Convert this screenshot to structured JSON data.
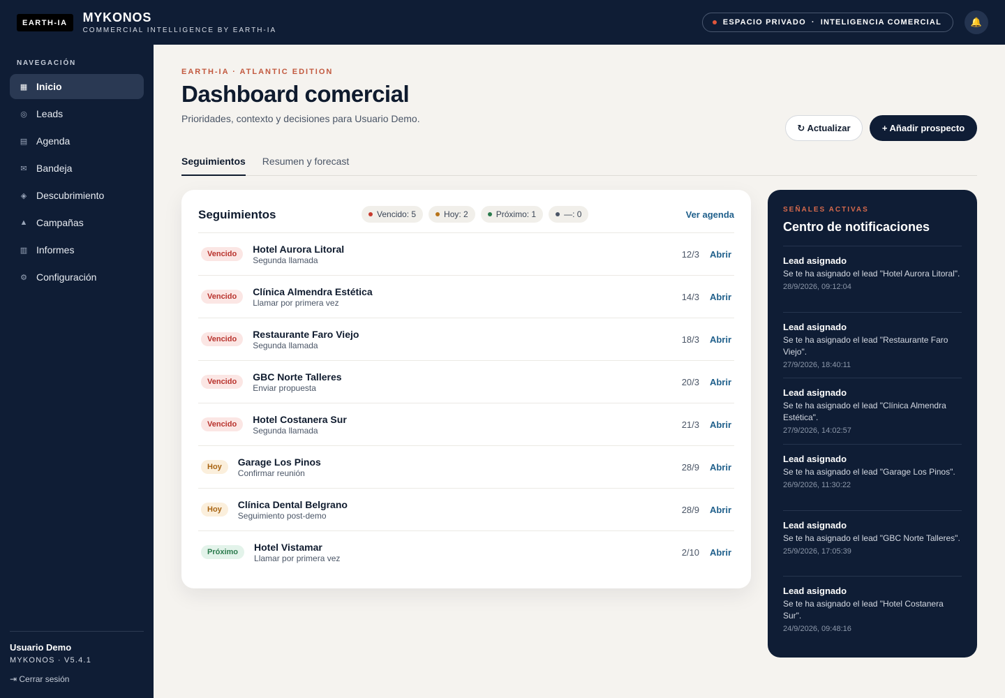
{
  "topbar": {
    "logo": "EARTH-IA",
    "brand_title": "MYKONOS",
    "brand_subtitle": "COMMERCIAL INTELLIGENCE BY EARTH-IA",
    "space_left": "ESPACIO PRIVADO",
    "space_sep": "·",
    "space_right": "INTELIGENCIA COMERCIAL",
    "bell_icon": "🔔"
  },
  "sidebar": {
    "heading": "NAVEGACIÓN",
    "items": [
      {
        "label": "Inicio",
        "icon": "▦",
        "name": "inicio"
      },
      {
        "label": "Leads",
        "icon": "◎",
        "name": "leads"
      },
      {
        "label": "Agenda",
        "icon": "▤",
        "name": "agenda"
      },
      {
        "label": "Bandeja",
        "icon": "✉",
        "name": "bandeja"
      },
      {
        "label": "Descubrimiento",
        "icon": "◈",
        "name": "descubrimiento"
      },
      {
        "label": "Campañas",
        "icon": "▲",
        "name": "campanas"
      },
      {
        "label": "Informes",
        "icon": "▥",
        "name": "informes"
      },
      {
        "label": "Configuración",
        "icon": "⚙",
        "name": "configuracion"
      }
    ],
    "active_index": 0,
    "user_name": "Usuario Demo",
    "version": "MYKONOS · V5.4.1",
    "logout": "⇥ Cerrar sesión"
  },
  "header": {
    "eyebrow": "EARTH-IA · ATLANTIC EDITION",
    "title": "Dashboard comercial",
    "subtitle": "Prioridades, contexto y decisiones para Usuario Demo.",
    "refresh_label": "↻ Actualizar",
    "add_label": "+ Añadir prospecto"
  },
  "tabs": [
    {
      "label": "Seguimientos",
      "active": true
    },
    {
      "label": "Resumen y forecast",
      "active": false
    }
  ],
  "followups": {
    "title": "Seguimientos",
    "link": "Ver agenda",
    "chips": [
      {
        "label": "Vencido: 5",
        "color": "#c73a2e"
      },
      {
        "label": "Hoy: 2",
        "color": "#b8741a"
      },
      {
        "label": "Próximo: 1",
        "color": "#2a7a4c"
      },
      {
        "label": "—: 0",
        "color": "#4a5566"
      }
    ],
    "open_label": "Abrir",
    "rows": [
      {
        "status": "Vencido",
        "kind": "vencido",
        "name": "Hotel Aurora Litoral",
        "task": "Segunda llamada",
        "date": "12/3"
      },
      {
        "status": "Vencido",
        "kind": "vencido",
        "name": "Clínica Almendra Estética",
        "task": "Llamar por primera vez",
        "date": "14/3"
      },
      {
        "status": "Vencido",
        "kind": "vencido",
        "name": "Restaurante Faro Viejo",
        "task": "Segunda llamada",
        "date": "18/3"
      },
      {
        "status": "Vencido",
        "kind": "vencido",
        "name": "GBC Norte Talleres",
        "task": "Enviar propuesta",
        "date": "20/3"
      },
      {
        "status": "Vencido",
        "kind": "vencido",
        "name": "Hotel Costanera Sur",
        "task": "Segunda llamada",
        "date": "21/3"
      },
      {
        "status": "Hoy",
        "kind": "hoy",
        "name": "Garage Los Pinos",
        "task": "Confirmar reunión",
        "date": "28/9"
      },
      {
        "status": "Hoy",
        "kind": "hoy",
        "name": "Clínica Dental Belgrano",
        "task": "Seguimiento post-demo",
        "date": "28/9"
      },
      {
        "status": "Próximo",
        "kind": "proximo",
        "name": "Hotel Vistamar",
        "task": "Llamar por primera vez",
        "date": "2/10"
      }
    ]
  },
  "notifications": {
    "eyebrow": "SEÑALES ACTIVAS",
    "title": "Centro de notificaciones",
    "items": [
      {
        "title": "Lead asignado",
        "body": "Se te ha asignado el lead \"Hotel Aurora Litoral\".",
        "time": "28/9/2026, 09:12:04"
      },
      {
        "title": "Lead asignado",
        "body": "Se te ha asignado el lead \"Restaurante Faro Viejo\".",
        "time": "27/9/2026, 18:40:11"
      },
      {
        "title": "Lead asignado",
        "body": "Se te ha asignado el lead \"Clínica Almendra Estética\".",
        "time": "27/9/2026, 14:02:57"
      },
      {
        "title": "Lead asignado",
        "body": "Se te ha asignado el lead \"Garage Los Pinos\".",
        "time": "26/9/2026, 11:30:22"
      },
      {
        "title": "Lead asignado",
        "body": "Se te ha asignado el lead \"GBC Norte Talleres\".",
        "time": "25/9/2026, 17:05:39"
      },
      {
        "title": "Lead asignado",
        "body": "Se te ha asignado el lead \"Hotel Costanera Sur\".",
        "time": "24/9/2026, 09:48:16"
      }
    ]
  }
}
